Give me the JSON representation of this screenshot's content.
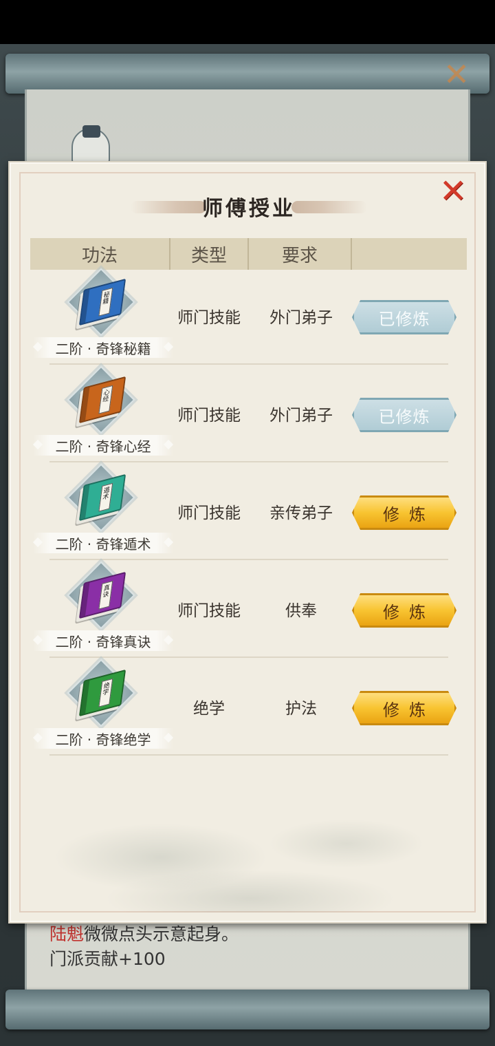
{
  "background": {
    "story_npc": "陆魁",
    "story_action": "微微点头示意起身。",
    "reward_text": "门派贡献+100"
  },
  "dialog": {
    "title": "师傅授业",
    "close_icon": "close-x-icon"
  },
  "table": {
    "headers": {
      "skill": "功法",
      "type": "类型",
      "requirement": "要求",
      "action": ""
    },
    "rows": [
      {
        "name": "二阶 · 奇锋秘籍",
        "type": "师门技能",
        "requirement": "外门弟子",
        "button": "已修炼",
        "status": "learned",
        "book_color": "#2f6fc0",
        "book_label": "秘籍",
        "icon": "blue-book-icon"
      },
      {
        "name": "二阶 · 奇锋心经",
        "type": "师门技能",
        "requirement": "外门弟子",
        "button": "已修炼",
        "status": "learned",
        "book_color": "#c8651c",
        "book_label": "心经",
        "icon": "orange-book-icon"
      },
      {
        "name": "二阶 · 奇锋遁术",
        "type": "师门技能",
        "requirement": "亲传弟子",
        "button": "修炼",
        "status": "available",
        "book_color": "#2fae94",
        "book_label": "遁术",
        "icon": "teal-book-icon"
      },
      {
        "name": "二阶 · 奇锋真诀",
        "type": "师门技能",
        "requirement": "供奉",
        "button": "修炼",
        "status": "available",
        "book_color": "#8a2fa6",
        "book_label": "真诀",
        "icon": "purple-book-icon"
      },
      {
        "name": "二阶 · 奇锋绝学",
        "type": "绝学",
        "requirement": "护法",
        "button": "修炼",
        "status": "available",
        "book_color": "#2f9a3e",
        "book_label": "绝学",
        "icon": "green-book-icon"
      }
    ]
  },
  "colors": {
    "learned_button": "#aecbd4",
    "train_button": "#f8c431",
    "close_red": "#d23a2a"
  }
}
